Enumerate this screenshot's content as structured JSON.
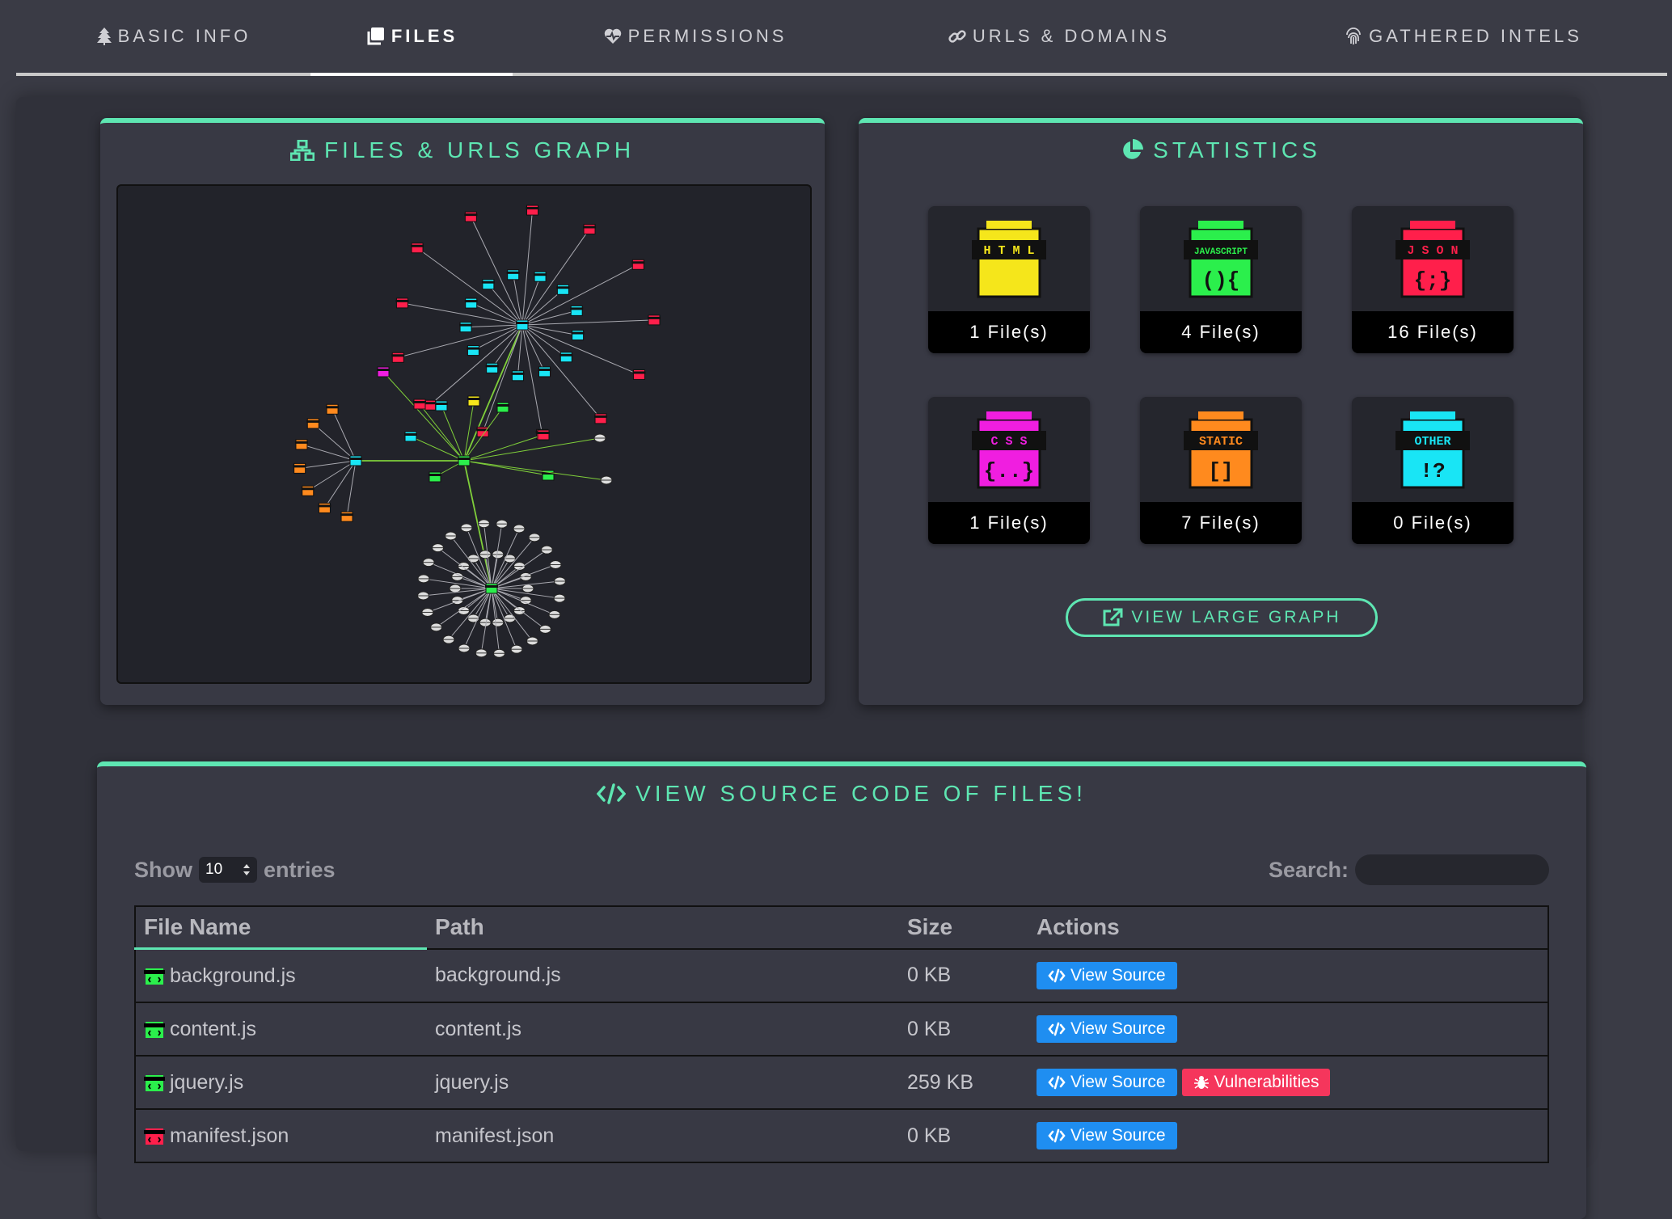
{
  "tabs": [
    {
      "label": "Basic Info",
      "icon": "tree-icon",
      "active": false
    },
    {
      "label": "Files",
      "icon": "copy-icon",
      "active": true
    },
    {
      "label": "Permissions",
      "icon": "heart-pulse-icon",
      "active": false
    },
    {
      "label": "URLs & Domains",
      "icon": "link-icon",
      "active": false
    },
    {
      "label": "Gathered Intels",
      "icon": "fingerprint-icon",
      "active": false
    }
  ],
  "graph_card": {
    "title": "Files & URLs Graph",
    "icon": "sitemap-icon"
  },
  "stats_card": {
    "title": "Statistics",
    "icon": "pie-chart-icon",
    "tiles": [
      {
        "type": "HTML",
        "glyph": "</>",
        "count": "1 File(s)",
        "color": "#f5e61b"
      },
      {
        "type": "JAVASCRIPT",
        "glyph": "(){",
        "count": "4 File(s)",
        "color": "#2bef4c"
      },
      {
        "type": "JSON",
        "glyph": "{;}",
        "count": "16 File(s)",
        "color": "#ff1f4b"
      },
      {
        "type": "CSS",
        "glyph": "{..}",
        "count": "1 File(s)",
        "color": "#f01ee0"
      },
      {
        "type": "STATIC",
        "glyph": "[]",
        "count": "7 File(s)",
        "color": "#ff8a1e"
      },
      {
        "type": "OTHER",
        "glyph": "!?",
        "count": "0 File(s)",
        "color": "#19e5f5"
      }
    ],
    "button_label": "View Large Graph"
  },
  "source_card": {
    "title": "View Source Code of Files!",
    "show_label": "Show",
    "entries_value": "10",
    "entries_label": "entries",
    "search_label": "Search:",
    "search_value": "",
    "columns": [
      "File Name",
      "Path",
      "Size",
      "Actions"
    ],
    "view_source_label": "View Source",
    "vuln_label": "Vulnerabilities",
    "rows": [
      {
        "name": "background.js",
        "path": "background.js",
        "size": "0 KB",
        "kind": "js",
        "vuln": false
      },
      {
        "name": "content.js",
        "path": "content.js",
        "size": "0 KB",
        "kind": "js",
        "vuln": false
      },
      {
        "name": "jquery.js",
        "path": "jquery.js",
        "size": "259 KB",
        "kind": "js",
        "vuln": true
      },
      {
        "name": "manifest.json",
        "path": "manifest.json",
        "size": "0 KB",
        "kind": "json",
        "vuln": false
      }
    ]
  },
  "colors": {
    "accent": "#5ee6b2",
    "blue_button": "#1f8ef1",
    "red_button": "#f5365c"
  }
}
